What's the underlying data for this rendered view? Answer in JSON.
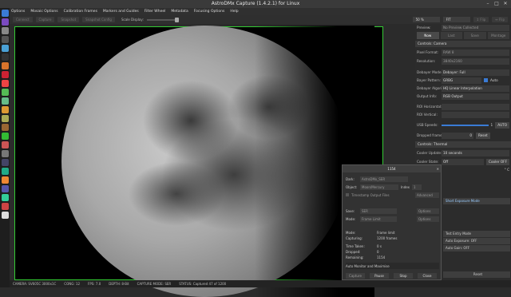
{
  "app": {
    "title": "AstroDMx Capture (1.4.2.1) for Linux"
  },
  "menu": [
    "Options",
    "Mosaic Options",
    "Calibration Frames",
    "Markers and Guides",
    "Filter Wheel",
    "Metadata",
    "Focusing Options",
    "Help"
  ],
  "toolbar": {
    "connect": "Connect",
    "capture": "Capture",
    "snapshot": "Snapshot",
    "snapshot_config": "Snapshot Config",
    "scale_label": "Scale Display:",
    "zoom": "50 %",
    "fit": "FIT",
    "fflip": "↕ Flip",
    "hflip": "↔ Flip"
  },
  "panel": {
    "preview_label": "Preview:",
    "preview_value": "No Preview Collected",
    "tabs": [
      "Now",
      "Last",
      "Save",
      "Montage"
    ],
    "section_camera": "Controls: Camera",
    "pixel_format_label": "Pixel Format:",
    "pixel_format": "RAW 8",
    "resolution_label": "Resolution:",
    "resolution": "3840x2160",
    "debayer_mode_label": "Debayer Mode:",
    "debayer_mode": "Debayer: Full",
    "bayer_pattern_label": "Bayer Pattern:",
    "bayer_pattern": "GRBG",
    "auto_label": "Auto",
    "debayer_algorithm_label": "Debayer Algorithm:",
    "debayer_algorithm": "HQ Linear Interpolation",
    "output_info_label": "Output Info:",
    "output_info": "RGB Output",
    "roi_h_label": "ROI Horizontal:",
    "roi_v_label": "ROI Vertical:",
    "usb_speed_label": "USB Speeds:",
    "usb_speed_value": "1",
    "usb_auto": "AUTO",
    "dropped_label": "Dropped frames:",
    "dropped_value": "0",
    "reset": "Reset",
    "section_thermal": "Controls: Thermal",
    "cooler_update_label": "Cooler Update:",
    "cooler_update": "10 seconds",
    "cooler_state_label": "Cooler State:",
    "cooler_state": "Off",
    "cooler_off": "Cooler OFF",
    "temp_unit": "° C",
    "short_exposure": "Short Exposure Mode",
    "test_entry": "Test Entry Mode",
    "auto_exposure": "Auto Exposure: OFF",
    "auto_gain": "Auto Gain: OFF",
    "reset2": "Reset"
  },
  "dialog": {
    "title": "1154",
    "close": "✕",
    "dark_label": "Dark:",
    "dark_value": "AstroDMx_SER",
    "object_label": "Object:",
    "object_value": "Moon/Mercury",
    "index_label": "Index",
    "index_value": "1",
    "timestamp": "Timestamp Output Files",
    "advanced": "Advanced",
    "save_label": "Save:",
    "save_value": "SER",
    "options": "Options",
    "mode_label": "Mode:",
    "mode_value": "Frame Limit",
    "stat_mode_label": "Mode:",
    "stat_mode_value": "Frame limit",
    "capturing_label": "Capturing:",
    "capturing_value": "1200 frames",
    "time_taken_label": "Time Taken:",
    "time_taken_value": "0 s",
    "dropped_label": "Dropped:",
    "dropped_value": "0",
    "remaining_label": "Remaining:",
    "remaining_value": "1154",
    "auto_monitor": "Auto Monitor and Maximise",
    "btn_capture": "Capture",
    "btn_pause": "Pause",
    "btn_stop": "Stop",
    "btn_close": "Close"
  },
  "status": [
    "CAMERA: SV605C 3000x1C",
    "CONG: 12",
    "FPS: 7.0",
    "DEPTH: 8-Bit",
    "CAPTURE MODE: SER",
    "STATUS: Captured 47 of 1200"
  ],
  "colors": {
    "frame_border": "#33cc33",
    "background": "#2b2b2b"
  }
}
